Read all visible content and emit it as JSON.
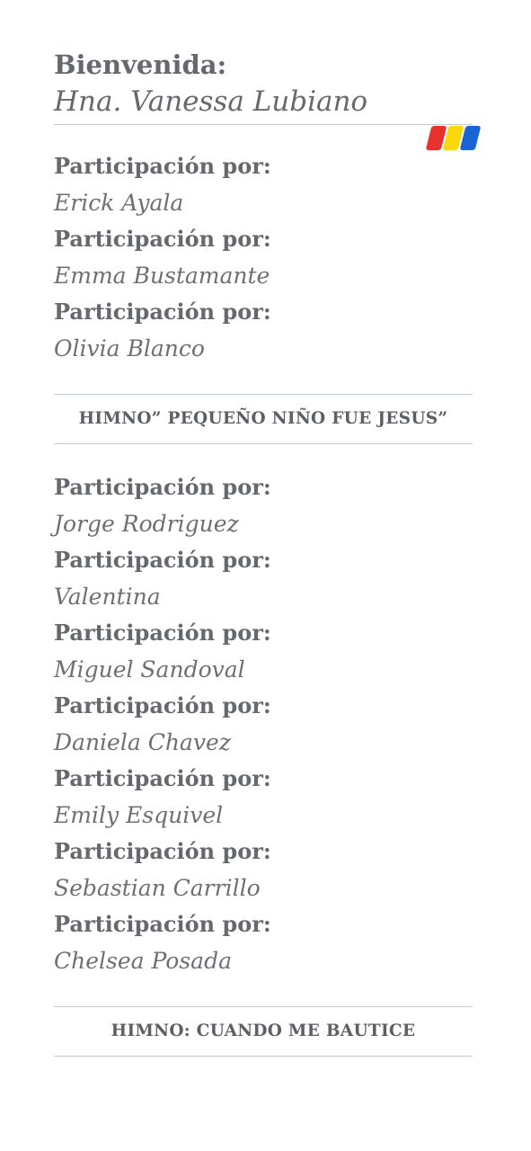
{
  "welcome": {
    "label": "Bienvenida:",
    "name": "Hna. Vanessa Lubiano"
  },
  "colors": {
    "text": "#65696d",
    "rule": "#c3ccd4",
    "stripe_red": "#e8322d",
    "stripe_yellow": "#f9d90d",
    "stripe_blue": "#1a63d4"
  },
  "participations_1": [
    {
      "role": "Participación por:",
      "name": "Erick Ayala"
    },
    {
      "role": "Participación por:",
      "name": "Emma Bustamante"
    },
    {
      "role": "Participación por:",
      "name": "Olivia Blanco"
    }
  ],
  "hymn_1": "HIMNO” PEQUEÑO NIÑO FUE JESUS”",
  "participations_2": [
    {
      "role": "Participación por:",
      "name": "Jorge Rodriguez"
    },
    {
      "role": "Participación por:",
      "name": "Valentina"
    },
    {
      "role": "Participación por:",
      "name": "Miguel Sandoval"
    },
    {
      "role": "Participación por:",
      "name": "Daniela Chavez"
    },
    {
      "role": "Participación por:",
      "name": "Emily Esquivel"
    },
    {
      "role": "Participación por:",
      "name": "Sebastian Carrillo"
    },
    {
      "role": "Participación por:",
      "name": "Chelsea Posada"
    }
  ],
  "hymn_2": "HIMNO: CUANDO ME BAUTICE"
}
